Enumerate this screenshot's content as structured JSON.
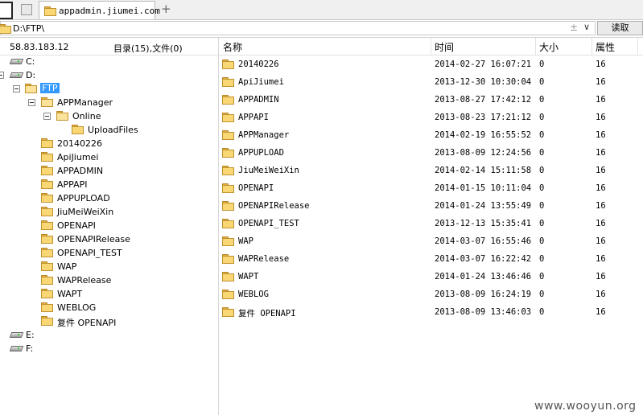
{
  "tab": {
    "title": "appadmin.jiumei.com",
    "add_symbol": "+"
  },
  "path": {
    "value": "D:\\FTP\\",
    "star": "±",
    "dropdown": "∨",
    "read_button": "读取"
  },
  "left_header": {
    "server": "58.83.183.12",
    "summary": "目录(15),文件(0)"
  },
  "tree": [
    {
      "label": "C:",
      "type": "drive"
    },
    {
      "label": "D:",
      "type": "drive",
      "expanded": true
    },
    {
      "label": "FTP",
      "type": "folder",
      "expanded": true,
      "selected": true
    },
    {
      "label": "APPManager",
      "type": "folder",
      "expanded": true
    },
    {
      "label": "Online",
      "type": "folder",
      "expanded": true
    },
    {
      "label": "UploadFiles",
      "type": "folder"
    },
    {
      "label": "20140226",
      "type": "folder"
    },
    {
      "label": "ApiJiumei",
      "type": "folder"
    },
    {
      "label": "APPADMIN",
      "type": "folder"
    },
    {
      "label": "APPAPI",
      "type": "folder"
    },
    {
      "label": "APPUPLOAD",
      "type": "folder"
    },
    {
      "label": "JiuMeiWeiXin",
      "type": "folder"
    },
    {
      "label": "OPENAPI",
      "type": "folder"
    },
    {
      "label": "OPENAPIRelease",
      "type": "folder"
    },
    {
      "label": "OPENAPI_TEST",
      "type": "folder"
    },
    {
      "label": "WAP",
      "type": "folder"
    },
    {
      "label": "WAPRelease",
      "type": "folder"
    },
    {
      "label": "WAPT",
      "type": "folder"
    },
    {
      "label": "WEBLOG",
      "type": "folder"
    },
    {
      "label": "复件 OPENAPI",
      "type": "folder"
    },
    {
      "label": "E:",
      "type": "drive"
    },
    {
      "label": "F:",
      "type": "drive"
    }
  ],
  "columns": {
    "name": "名称",
    "time": "时间",
    "size": "大小",
    "attr": "属性"
  },
  "rows": [
    {
      "name": "20140226",
      "time": "2014-02-27 16:07:21",
      "size": "0",
      "attr": "16"
    },
    {
      "name": "ApiJiumei",
      "time": "2013-12-30 10:30:04",
      "size": "0",
      "attr": "16"
    },
    {
      "name": "APPADMIN",
      "time": "2013-08-27 17:42:12",
      "size": "0",
      "attr": "16"
    },
    {
      "name": "APPAPI",
      "time": "2013-08-23 17:21:12",
      "size": "0",
      "attr": "16"
    },
    {
      "name": "APPManager",
      "time": "2014-02-19 16:55:52",
      "size": "0",
      "attr": "16"
    },
    {
      "name": "APPUPLOAD",
      "time": "2013-08-09 12:24:56",
      "size": "0",
      "attr": "16"
    },
    {
      "name": "JiuMeiWeiXin",
      "time": "2014-02-14 15:11:58",
      "size": "0",
      "attr": "16"
    },
    {
      "name": "OPENAPI",
      "time": "2014-01-15 10:11:04",
      "size": "0",
      "attr": "16"
    },
    {
      "name": "OPENAPIRelease",
      "time": "2014-01-24 13:55:49",
      "size": "0",
      "attr": "16"
    },
    {
      "name": "OPENAPI_TEST",
      "time": "2013-12-13 15:35:41",
      "size": "0",
      "attr": "16"
    },
    {
      "name": "WAP",
      "time": "2014-03-07 16:55:46",
      "size": "0",
      "attr": "16"
    },
    {
      "name": "WAPRelease",
      "time": "2014-03-07 16:22:42",
      "size": "0",
      "attr": "16"
    },
    {
      "name": "WAPT",
      "time": "2014-01-24 13:46:46",
      "size": "0",
      "attr": "16"
    },
    {
      "name": "WEBLOG",
      "time": "2013-08-09 16:24:19",
      "size": "0",
      "attr": "16"
    },
    {
      "name": "复件 OPENAPI",
      "time": "2013-08-09 13:46:03",
      "size": "0",
      "attr": "16"
    }
  ],
  "watermark": "www.wooyun.org",
  "colors": {
    "selection": "#3399ff",
    "folder": "#f8d774"
  }
}
